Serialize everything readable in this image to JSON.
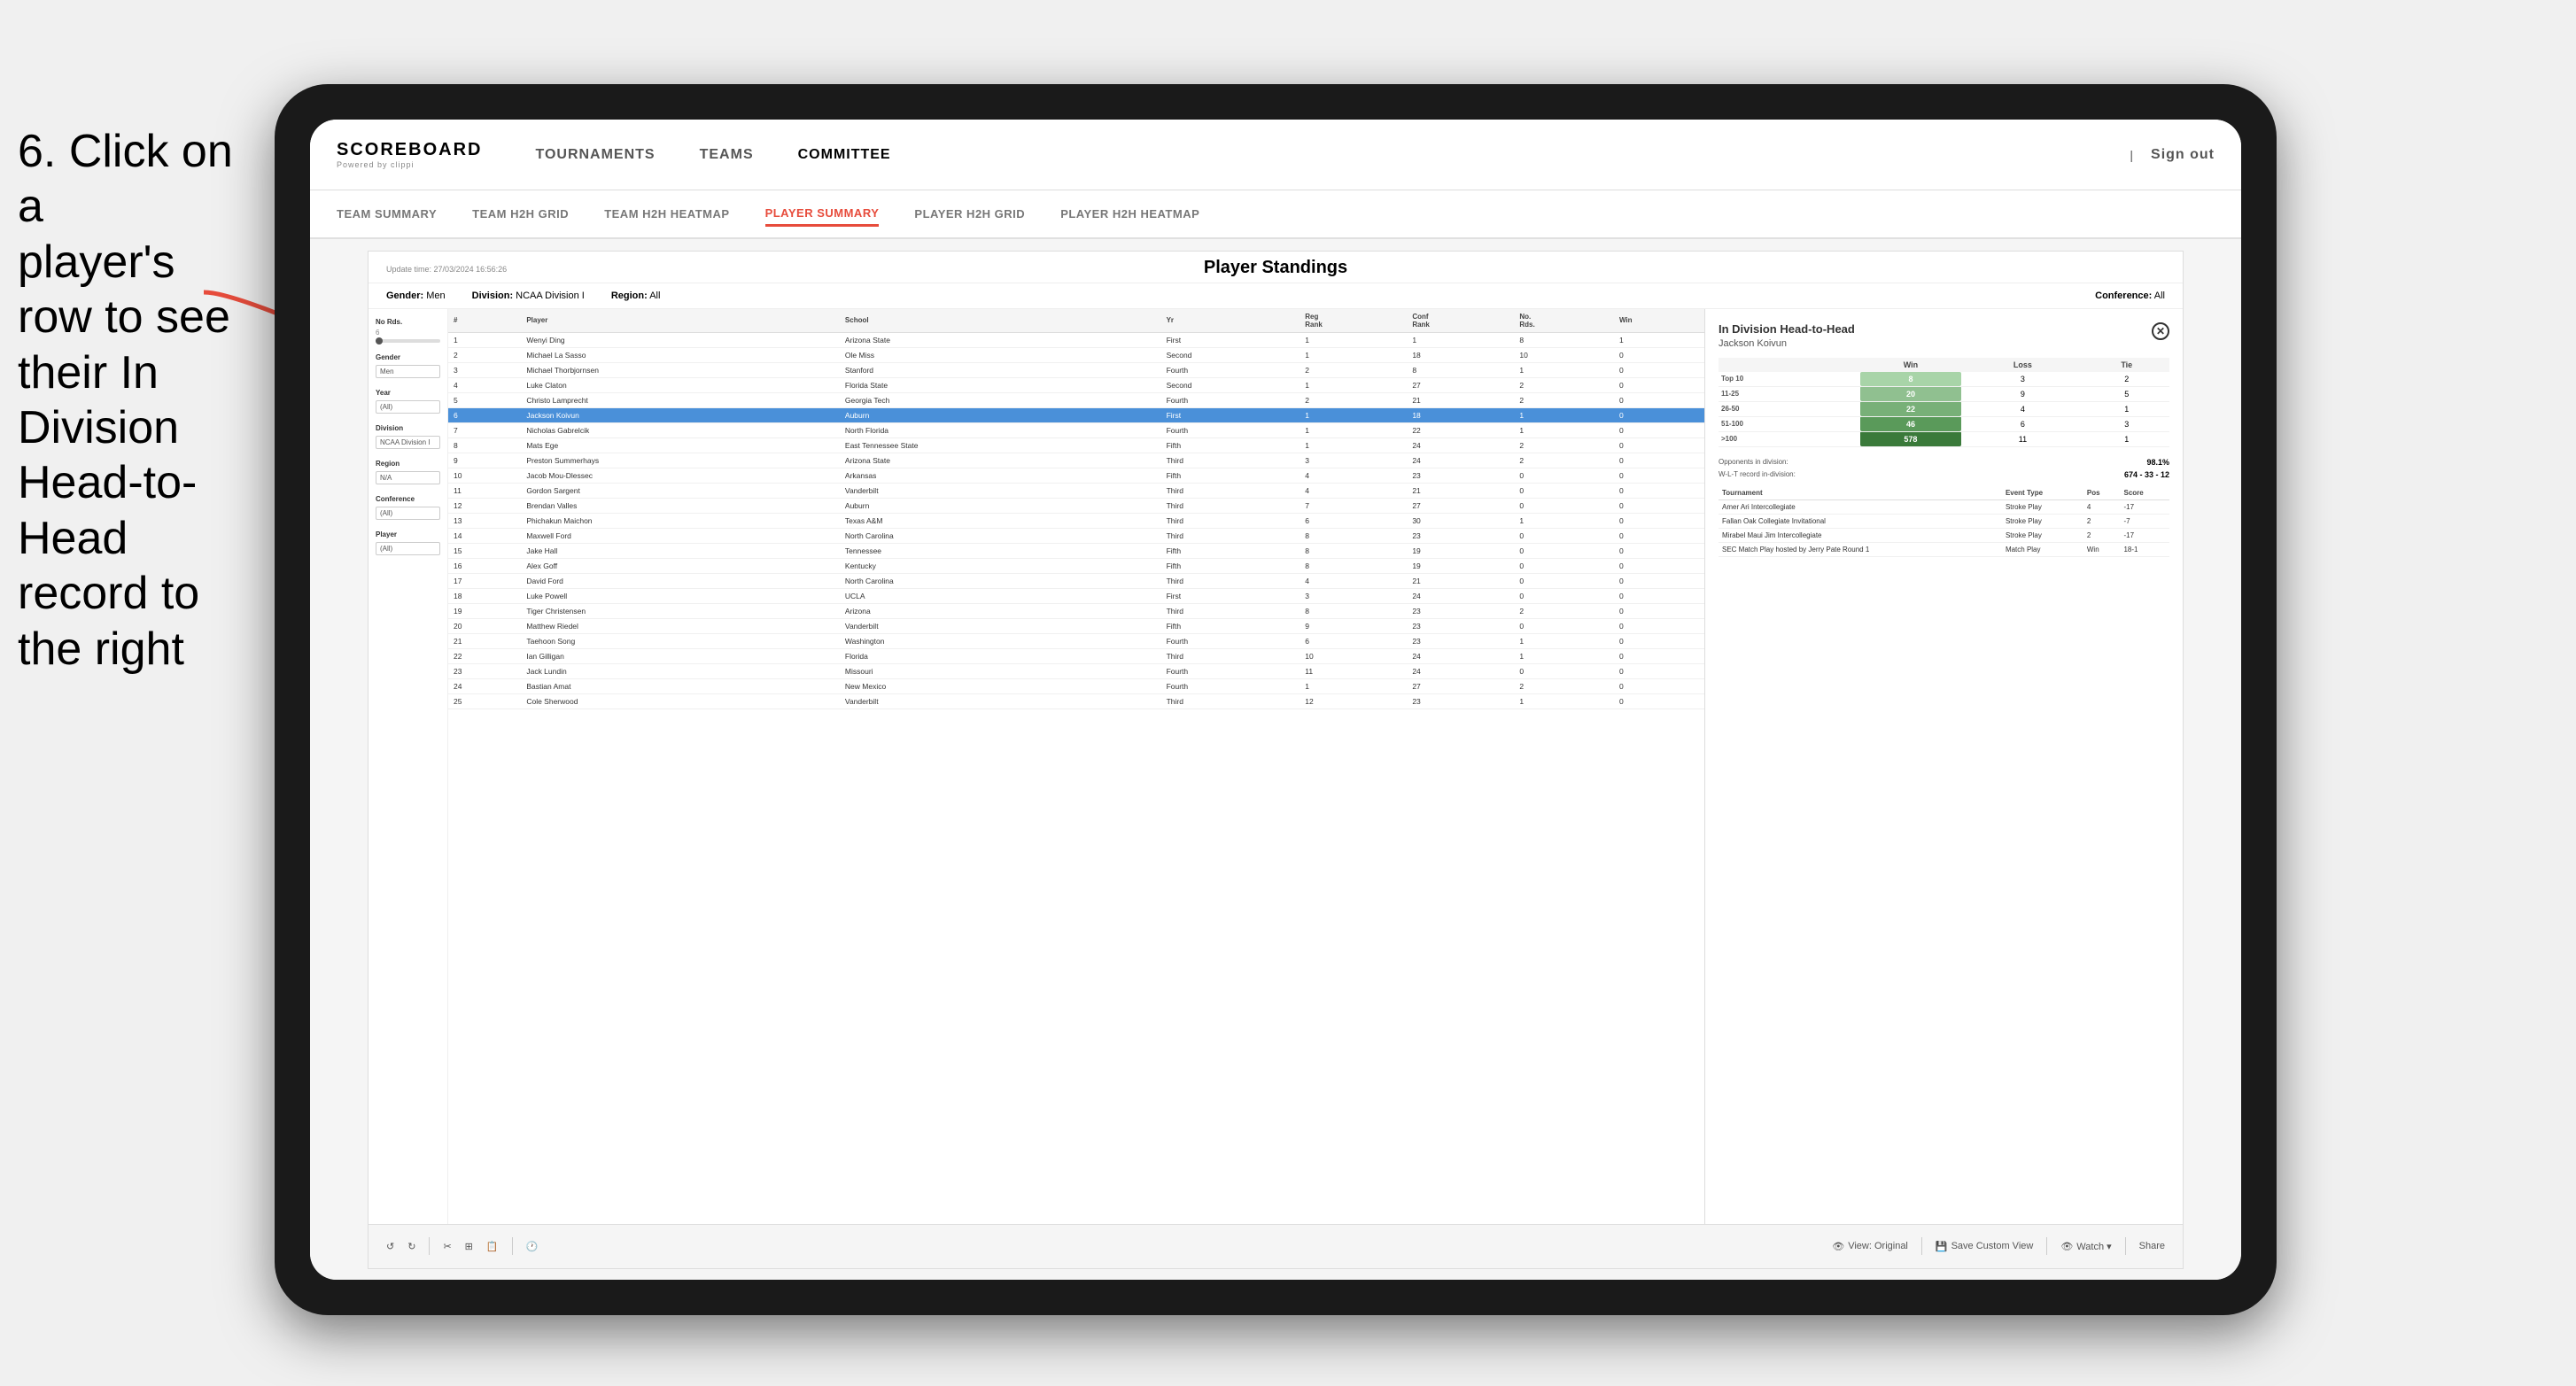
{
  "instruction": {
    "line1": "6. Click on a",
    "line2": "player's row to see",
    "line3": "their In Division",
    "line4": "Head-to-Head",
    "line5": "record to the right"
  },
  "nav": {
    "logo": "SCOREBOARD",
    "logo_sub": "Powered by clippi",
    "items": [
      "TOURNAMENTS",
      "TEAMS",
      "COMMITTEE"
    ],
    "right_items": [
      "Sign out"
    ]
  },
  "sub_nav": {
    "items": [
      "TEAM SUMMARY",
      "TEAM H2H GRID",
      "TEAM H2H HEATMAP",
      "PLAYER SUMMARY",
      "PLAYER H2H GRID",
      "PLAYER H2H HEATMAP"
    ],
    "active": "PLAYER SUMMARY"
  },
  "standings": {
    "update_time": "Update time:",
    "update_date": "27/03/2024 16:56:26",
    "title": "Player Standings",
    "filters": {
      "gender_label": "Gender:",
      "gender": "Men",
      "division_label": "Division:",
      "division": "NCAA Division I",
      "region_label": "Region:",
      "region": "All",
      "conference_label": "Conference:",
      "conference": "All"
    },
    "sidebar": {
      "no_rds_label": "No Rds.",
      "no_rds_min": "6",
      "no_rds_max": "—",
      "gender_label": "Gender",
      "gender_value": "Men",
      "year_label": "Year",
      "year_value": "(All)",
      "division_label": "Division",
      "division_value": "NCAA Division I",
      "region_label": "Region",
      "region_value": "N/A",
      "conference_label": "Conference",
      "conference_value": "(All)",
      "player_label": "Player",
      "player_value": "(All)"
    },
    "table_headers": [
      "#",
      "Player",
      "School",
      "Yr",
      "Reg Rank",
      "Conf Rank",
      "No. Rds.",
      "Win"
    ],
    "rows": [
      {
        "rank": 1,
        "player": "Wenyi Ding",
        "school": "Arizona State",
        "yr": "First",
        "reg_rank": 1,
        "conf_rank": 1,
        "no_rds": 8,
        "win": 1,
        "highlighted": false,
        "selected": false
      },
      {
        "rank": 2,
        "player": "Michael La Sasso",
        "school": "Ole Miss",
        "yr": "Second",
        "reg_rank": 1,
        "conf_rank": 18,
        "no_rds": 10,
        "win": 0,
        "highlighted": false,
        "selected": false
      },
      {
        "rank": 3,
        "player": "Michael Thorbjornsen",
        "school": "Stanford",
        "yr": "Fourth",
        "reg_rank": 2,
        "conf_rank": 8,
        "no_rds": 1,
        "win": 0,
        "highlighted": false,
        "selected": false
      },
      {
        "rank": 4,
        "player": "Luke Claton",
        "school": "Florida State",
        "yr": "Second",
        "reg_rank": 1,
        "conf_rank": 27,
        "no_rds": 2,
        "win": 0,
        "highlighted": false,
        "selected": false
      },
      {
        "rank": 5,
        "player": "Christo Lamprecht",
        "school": "Georgia Tech",
        "yr": "Fourth",
        "reg_rank": 2,
        "conf_rank": 21,
        "no_rds": 2,
        "win": 0,
        "highlighted": false,
        "selected": false
      },
      {
        "rank": 6,
        "player": "Jackson Koivun",
        "school": "Auburn",
        "yr": "First",
        "reg_rank": 1,
        "conf_rank": 18,
        "no_rds": 1,
        "win": 0,
        "highlighted": true,
        "selected": true
      },
      {
        "rank": 7,
        "player": "Nicholas Gabrelcik",
        "school": "North Florida",
        "yr": "Fourth",
        "reg_rank": 1,
        "conf_rank": 22,
        "no_rds": 1,
        "win": 0,
        "highlighted": false,
        "selected": false
      },
      {
        "rank": 8,
        "player": "Mats Ege",
        "school": "East Tennessee State",
        "yr": "Fifth",
        "reg_rank": 1,
        "conf_rank": 24,
        "no_rds": 2,
        "win": 0,
        "highlighted": false,
        "selected": false
      },
      {
        "rank": 9,
        "player": "Preston Summerhays",
        "school": "Arizona State",
        "yr": "Third",
        "reg_rank": 3,
        "conf_rank": 24,
        "no_rds": 2,
        "win": 0,
        "highlighted": false,
        "selected": false
      },
      {
        "rank": 10,
        "player": "Jacob Mou-Dlessec",
        "school": "Arkansas",
        "yr": "Fifth",
        "reg_rank": 4,
        "conf_rank": 23,
        "no_rds": 0,
        "win": 0,
        "highlighted": false,
        "selected": false
      },
      {
        "rank": 11,
        "player": "Gordon Sargent",
        "school": "Vanderbilt",
        "yr": "Third",
        "reg_rank": 4,
        "conf_rank": 21,
        "no_rds": 0,
        "win": 0,
        "highlighted": false,
        "selected": false
      },
      {
        "rank": 12,
        "player": "Brendan Valles",
        "school": "Auburn",
        "yr": "Third",
        "reg_rank": 7,
        "conf_rank": 27,
        "no_rds": 0,
        "win": 0,
        "highlighted": false,
        "selected": false
      },
      {
        "rank": 13,
        "player": "Phichakun Maichon",
        "school": "Texas A&M",
        "yr": "Third",
        "reg_rank": 6,
        "conf_rank": 30,
        "no_rds": 1,
        "win": 0,
        "highlighted": false,
        "selected": false
      },
      {
        "rank": 14,
        "player": "Maxwell Ford",
        "school": "North Carolina",
        "yr": "Third",
        "reg_rank": 8,
        "conf_rank": 23,
        "no_rds": 0,
        "win": 0,
        "highlighted": false,
        "selected": false
      },
      {
        "rank": 15,
        "player": "Jake Hall",
        "school": "Tennessee",
        "yr": "Fifth",
        "reg_rank": 8,
        "conf_rank": 19,
        "no_rds": 0,
        "win": 0,
        "highlighted": false,
        "selected": false
      },
      {
        "rank": 16,
        "player": "Alex Goff",
        "school": "Kentucky",
        "yr": "Fifth",
        "reg_rank": 8,
        "conf_rank": 19,
        "no_rds": 0,
        "win": 0,
        "highlighted": false,
        "selected": false
      },
      {
        "rank": 17,
        "player": "David Ford",
        "school": "North Carolina",
        "yr": "Third",
        "reg_rank": 4,
        "conf_rank": 21,
        "no_rds": 0,
        "win": 0,
        "highlighted": false,
        "selected": false
      },
      {
        "rank": 18,
        "player": "Luke Powell",
        "school": "UCLA",
        "yr": "First",
        "reg_rank": 3,
        "conf_rank": 24,
        "no_rds": 0,
        "win": 0,
        "highlighted": false,
        "selected": false
      },
      {
        "rank": 19,
        "player": "Tiger Christensen",
        "school": "Arizona",
        "yr": "Third",
        "reg_rank": 8,
        "conf_rank": 23,
        "no_rds": 2,
        "win": 0,
        "highlighted": false,
        "selected": false
      },
      {
        "rank": 20,
        "player": "Matthew Riedel",
        "school": "Vanderbilt",
        "yr": "Fifth",
        "reg_rank": 9,
        "conf_rank": 23,
        "no_rds": 0,
        "win": 0,
        "highlighted": false,
        "selected": false
      },
      {
        "rank": 21,
        "player": "Taehoon Song",
        "school": "Washington",
        "yr": "Fourth",
        "reg_rank": 6,
        "conf_rank": 23,
        "no_rds": 1,
        "win": 0,
        "highlighted": false,
        "selected": false
      },
      {
        "rank": 22,
        "player": "Ian Gilligan",
        "school": "Florida",
        "yr": "Third",
        "reg_rank": 10,
        "conf_rank": 24,
        "no_rds": 1,
        "win": 0,
        "highlighted": false,
        "selected": false
      },
      {
        "rank": 23,
        "player": "Jack Lundin",
        "school": "Missouri",
        "yr": "Fourth",
        "reg_rank": 11,
        "conf_rank": 24,
        "no_rds": 0,
        "win": 0,
        "highlighted": false,
        "selected": false
      },
      {
        "rank": 24,
        "player": "Bastian Amat",
        "school": "New Mexico",
        "yr": "Fourth",
        "reg_rank": 1,
        "conf_rank": 27,
        "no_rds": 2,
        "win": 0,
        "highlighted": false,
        "selected": false
      },
      {
        "rank": 25,
        "player": "Cole Sherwood",
        "school": "Vanderbilt",
        "yr": "Third",
        "reg_rank": 12,
        "conf_rank": 23,
        "no_rds": 1,
        "win": 0,
        "highlighted": false,
        "selected": false
      }
    ]
  },
  "h2h": {
    "title": "In Division Head-to-Head",
    "player_name": "Jackson Koivun",
    "table": {
      "headers": [
        "",
        "Win",
        "Loss",
        "Tie"
      ],
      "rows": [
        {
          "label": "Top 10",
          "win": "8",
          "loss": "3",
          "tie": "2"
        },
        {
          "label": "11-25",
          "win": "20",
          "loss": "9",
          "tie": "5"
        },
        {
          "label": "26-50",
          "win": "22",
          "loss": "4",
          "tie": "1"
        },
        {
          "label": "51-100",
          "win": "46",
          "loss": "6",
          "tie": "3"
        },
        {
          "label": ">100",
          "win": "578",
          "loss": "11",
          "tie": "1"
        }
      ]
    },
    "opponents_label": "Opponents in division:",
    "opponents_pct": "98.1%",
    "wlt_label": "W-L-T record in-division:",
    "wlt_value": "674 - 33 - 12",
    "tournament_headers": [
      "Tournament",
      "Event Type",
      "Pos",
      "Score"
    ],
    "tournament_rows": [
      {
        "tournament": "Amer Ari Intercollegiate",
        "event_type": "Stroke Play",
        "pos": 4,
        "score": "-17"
      },
      {
        "tournament": "Fallan Oak Collegiate Invitational",
        "event_type": "Stroke Play",
        "pos": 2,
        "score": "-7"
      },
      {
        "tournament": "Mirabel Maui Jim Intercollegiate",
        "event_type": "Stroke Play",
        "pos": 2,
        "score": "-17"
      },
      {
        "tournament": "SEC Match Play hosted by Jerry Pate Round 1",
        "event_type": "Match Play",
        "pos": "Win",
        "score": "18-1"
      }
    ]
  },
  "toolbar": {
    "undo_label": "↺",
    "redo_label": "↻",
    "view_original": "View: Original",
    "save_custom": "Save Custom View",
    "watch_label": "Watch ▾",
    "share_label": "Share"
  }
}
